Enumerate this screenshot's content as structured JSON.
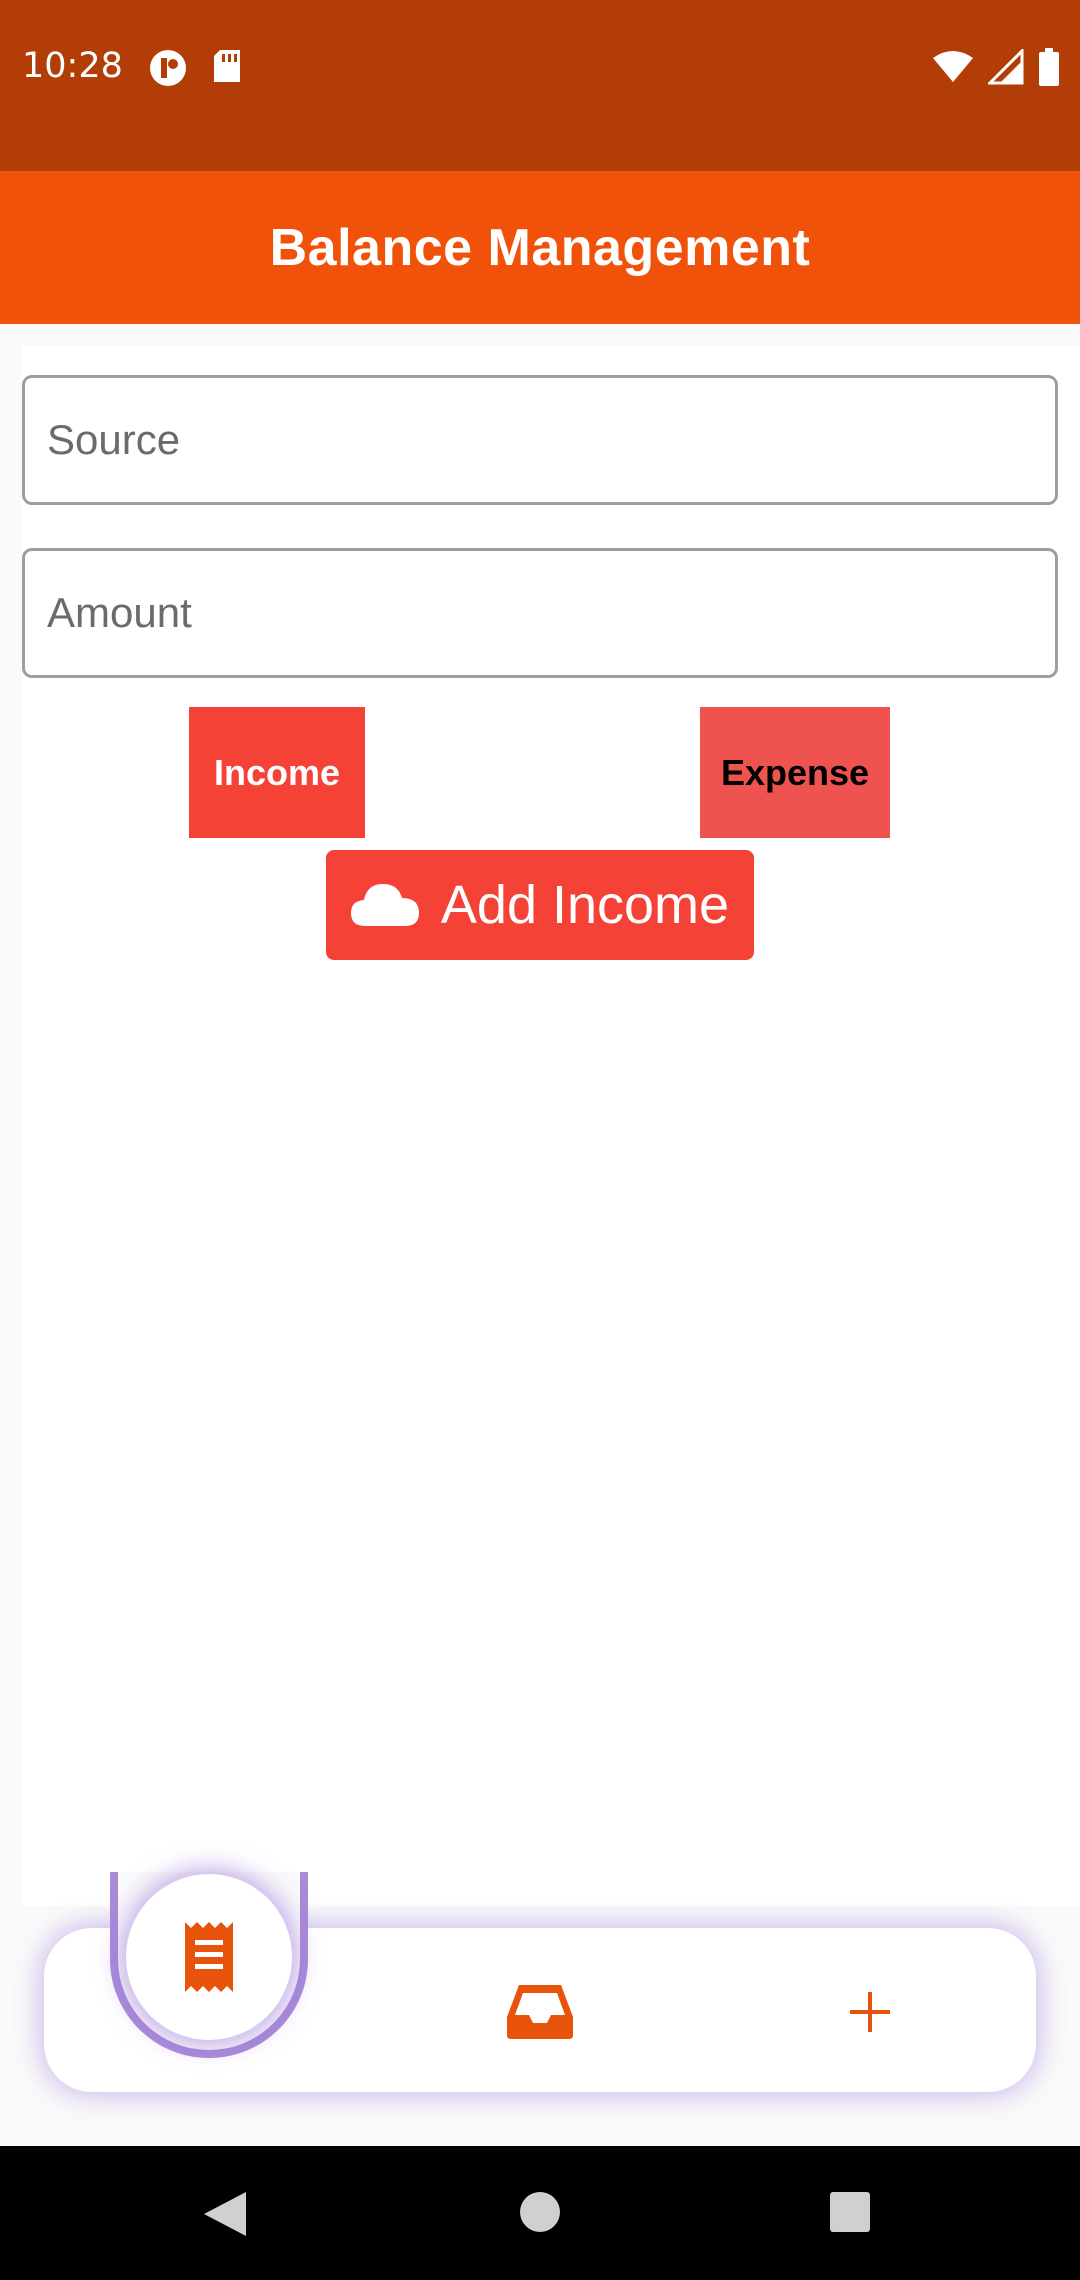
{
  "status_bar": {
    "time": "10:28",
    "left_icons": [
      "notification-app-icon",
      "sd-card-icon"
    ],
    "right_icons": [
      "wifi-icon",
      "cell-signal-icon",
      "battery-icon"
    ]
  },
  "app_bar": {
    "title": "Balance Management"
  },
  "form": {
    "source_placeholder": "Source",
    "amount_placeholder": "Amount",
    "income_label": "Income",
    "expense_label": "Expense",
    "add_button_label": "Add Income",
    "add_button_icon": "cloud-icon"
  },
  "bottom_nav": {
    "items": [
      {
        "icon": "receipt-icon",
        "selected": true
      },
      {
        "icon": "inbox-icon",
        "selected": false
      },
      {
        "icon": "plus-icon",
        "selected": false
      }
    ]
  },
  "colors": {
    "status_bar": "#b33d06",
    "app_bar": "#f0520a",
    "accent_red": "#f44336",
    "expense_red": "#ef5350",
    "nav_icon": "#e8530c",
    "nav_glow": "#a98bd8"
  }
}
